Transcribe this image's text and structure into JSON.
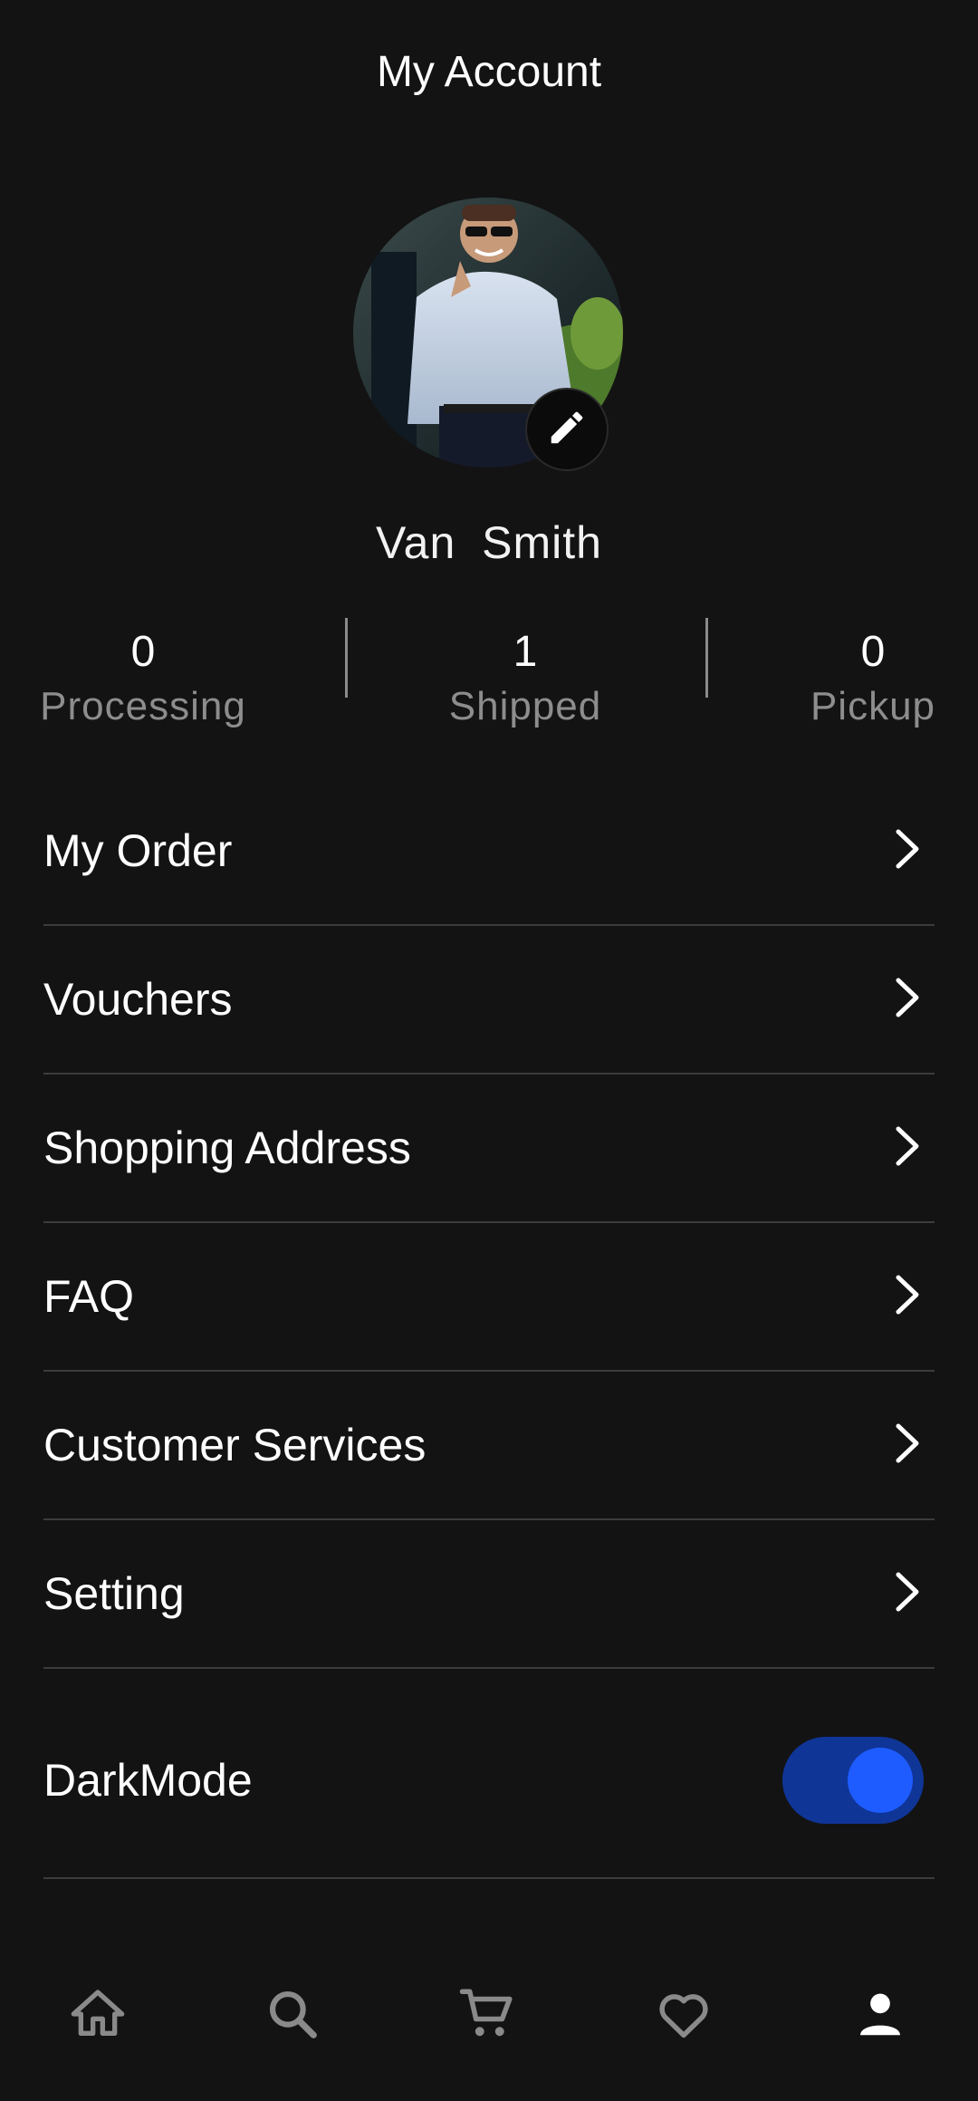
{
  "header": {
    "title": "My Account"
  },
  "profile": {
    "first_name": "Van",
    "last_name": "Smith"
  },
  "stats": [
    {
      "value": "0",
      "label": "Processing"
    },
    {
      "value": "1",
      "label": "Shipped"
    },
    {
      "value": "0",
      "label": "Pickup"
    }
  ],
  "menu": [
    {
      "label": "My Order"
    },
    {
      "label": "Vouchers"
    },
    {
      "label": "Shopping Address"
    },
    {
      "label": "FAQ"
    },
    {
      "label": "Customer Services"
    },
    {
      "label": "Setting"
    }
  ],
  "dark_mode": {
    "label": "DarkMode",
    "enabled": true
  },
  "bottom_nav": [
    {
      "icon": "home-icon",
      "active": false
    },
    {
      "icon": "search-icon",
      "active": false
    },
    {
      "icon": "cart-icon",
      "active": false
    },
    {
      "icon": "heart-icon",
      "active": false
    },
    {
      "icon": "profile-icon",
      "active": true
    }
  ],
  "colors": {
    "background": "#131313",
    "accent": "#1e5cff",
    "toggle_track": "#0f3597",
    "muted_text": "#8d8d8d",
    "divider": "#3c3c3c",
    "nav_inactive": "#8a8a8a",
    "nav_active": "#ffffff"
  }
}
